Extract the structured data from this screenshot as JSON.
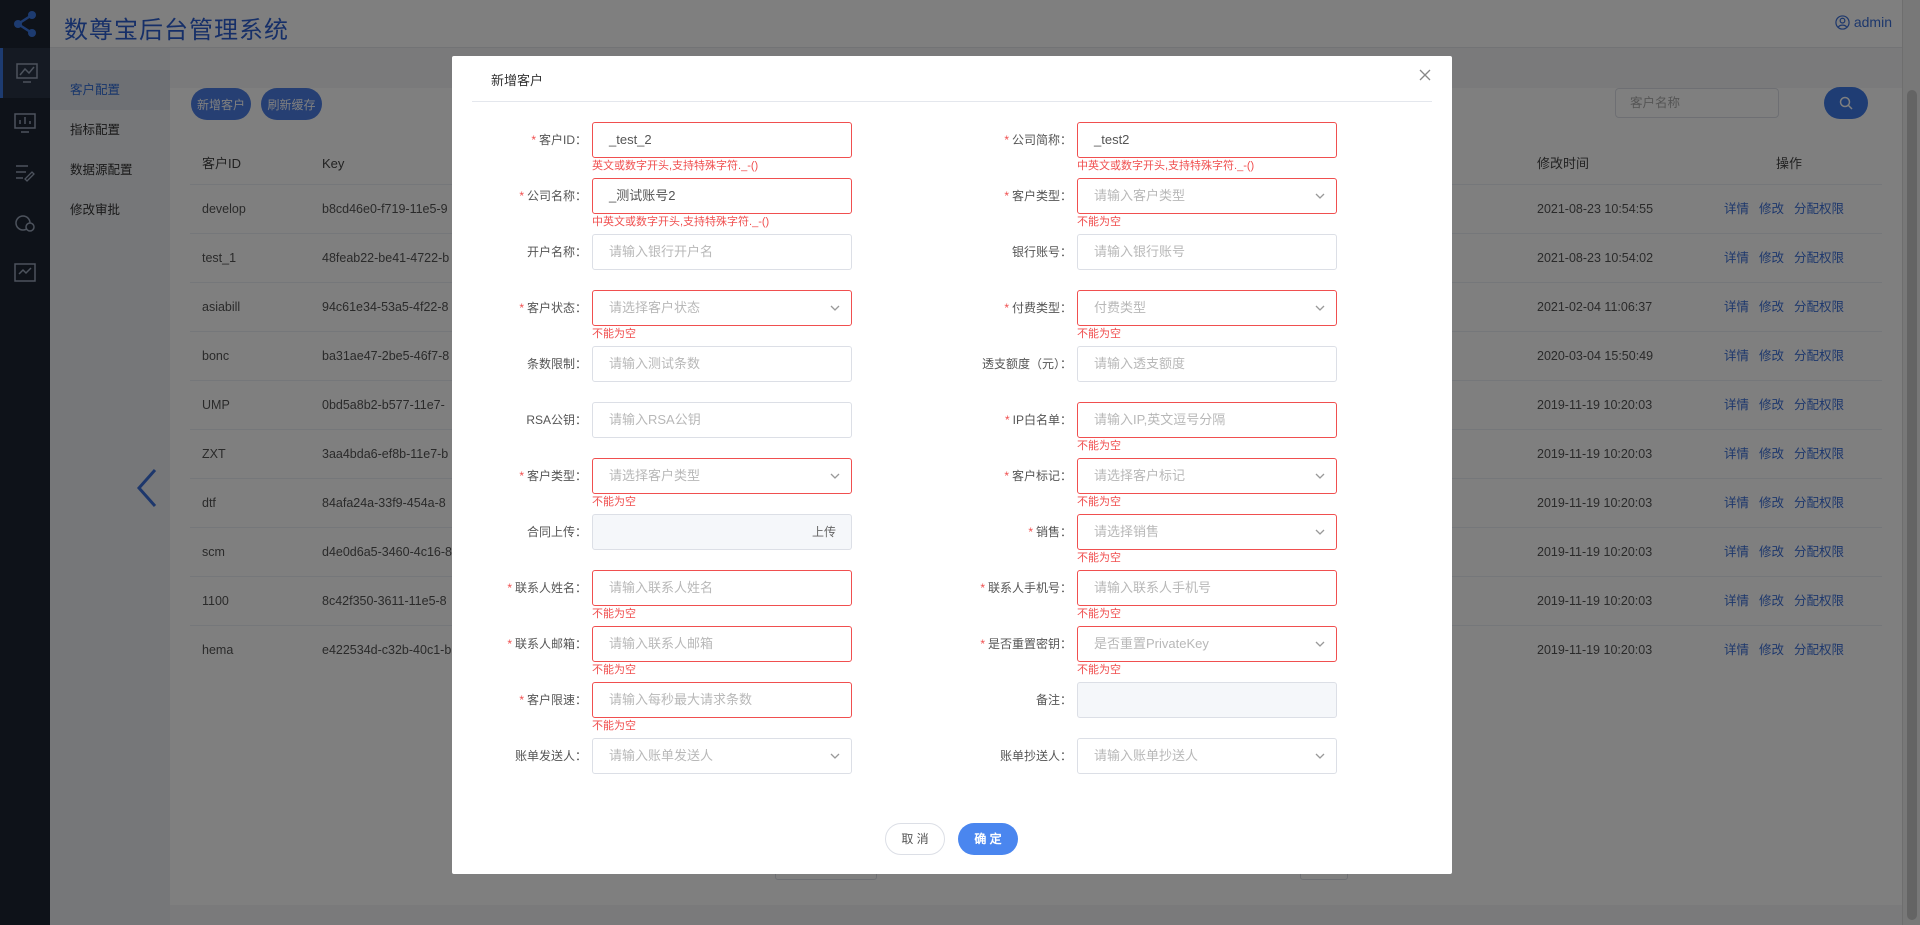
{
  "app": {
    "title": "数尊宝后台管理系统",
    "user": "admin"
  },
  "subnav": [
    "客户配置",
    "指标配置",
    "数据源配置",
    "修改审批"
  ],
  "toolbar": {
    "add": "新增客户",
    "refresh": "刷新缓存",
    "search_placeholder": "客户名称"
  },
  "table": {
    "headers": {
      "id": "客户ID",
      "key": "Key",
      "time": "修改时间",
      "ops": "操作"
    },
    "ops": [
      "详情",
      "修改",
      "分配权限"
    ],
    "rows": [
      {
        "id": "develop",
        "key": "b8cd46e0-f719-11e5-9",
        "time": "2021-08-23 10:54:55"
      },
      {
        "id": "test_1",
        "key": "48feab22-be41-4722-b",
        "time": "2021-08-23 10:54:02"
      },
      {
        "id": "asiabill",
        "key": "94c61e34-53a5-4f22-8",
        "time": "2021-02-04 11:06:37"
      },
      {
        "id": "bonc",
        "key": "ba31ae47-2be5-46f7-8",
        "time": "2020-03-04 15:50:49"
      },
      {
        "id": "UMP",
        "key": "0bd5a8b2-b577-11e7-",
        "time": "2019-11-19 10:20:03"
      },
      {
        "id": "ZXT",
        "key": "3aa4bda6-ef8b-11e7-b",
        "time": "2019-11-19 10:20:03"
      },
      {
        "id": "dtf",
        "key": "84afa24a-33f9-454a-8",
        "time": "2019-11-19 10:20:03"
      },
      {
        "id": "scm",
        "key": "d4e0d6a5-3460-4c16-8",
        "time": "2019-11-19 10:20:03"
      },
      {
        "id": "1100",
        "key": "8c42f350-3611-11e5-8",
        "time": "2019-11-19 10:20:03"
      },
      {
        "id": "hema",
        "key": "e422534d-c32b-40c1-b",
        "time": "2019-11-19 10:20:03"
      }
    ]
  },
  "modal": {
    "title": "新增客户",
    "fields": {
      "customer_id": {
        "label": "客户ID：",
        "value": "_test_2",
        "error": "英文或数字开头,支持特殊字符._-()"
      },
      "company_short": {
        "label": "公司简称：",
        "value": "_test2",
        "error": "中英文或数字开头,支持特殊字符._-()"
      },
      "company_name": {
        "label": "公司名称：",
        "value": "_测试账号2",
        "error": "中英文或数字开头,支持特殊字符._-()"
      },
      "customer_type_top": {
        "label": "客户类型：",
        "placeholder": "请输入客户类型",
        "error": "不能为空"
      },
      "account_name": {
        "label": "开户名称：",
        "placeholder": "请输入银行开户名"
      },
      "bank_account": {
        "label": "银行账号：",
        "placeholder": "请输入银行账号"
      },
      "customer_status": {
        "label": "客户状态：",
        "placeholder": "请选择客户状态",
        "error": "不能为空"
      },
      "pay_type": {
        "label": "付费类型：",
        "placeholder": "付费类型",
        "error": "不能为空"
      },
      "count_limit": {
        "label": "条数限制：",
        "placeholder": "请输入测试条数"
      },
      "overdraft": {
        "label": "透支额度（元）：",
        "placeholder": "请输入透支额度"
      },
      "rsa_key": {
        "label": "RSA公钥：",
        "placeholder": "请输入RSA公钥"
      },
      "ip_whitelist": {
        "label": "IP白名单：",
        "placeholder": "请输入IP,英文逗号分隔",
        "error": "不能为空"
      },
      "customer_type": {
        "label": "客户类型：",
        "placeholder": "请选择客户类型",
        "error": "不能为空"
      },
      "customer_tag": {
        "label": "客户标记：",
        "placeholder": "请选择客户标记",
        "error": "不能为空"
      },
      "contract_upload": {
        "label": "合同上传：",
        "button": "上传"
      },
      "sales": {
        "label": "销售：",
        "placeholder": "请选择销售",
        "error": "不能为空"
      },
      "contact_name": {
        "label": "联系人姓名：",
        "placeholder": "请输入联系人姓名",
        "error": "不能为空"
      },
      "contact_phone": {
        "label": "联系人手机号：",
        "placeholder": "请输入联系人手机号",
        "error": "不能为空"
      },
      "contact_email": {
        "label": "联系人邮箱：",
        "placeholder": "请输入联系人邮箱",
        "error": "不能为空"
      },
      "reset_key": {
        "label": "是否重置密钥：",
        "placeholder": "是否重置PrivateKey",
        "error": "不能为空"
      },
      "rate_limit": {
        "label": "客户限速：",
        "placeholder": "请输入每秒最大请求条数",
        "error": "不能为空"
      },
      "remark": {
        "label": "备注：",
        "placeholder": ""
      },
      "bill_sender": {
        "label": "账单发送人：",
        "placeholder": "请输入账单发送人"
      },
      "bill_cc": {
        "label": "账单抄送人：",
        "placeholder": "请输入账单抄送人"
      }
    },
    "cancel": "取 消",
    "confirm": "确 定"
  }
}
